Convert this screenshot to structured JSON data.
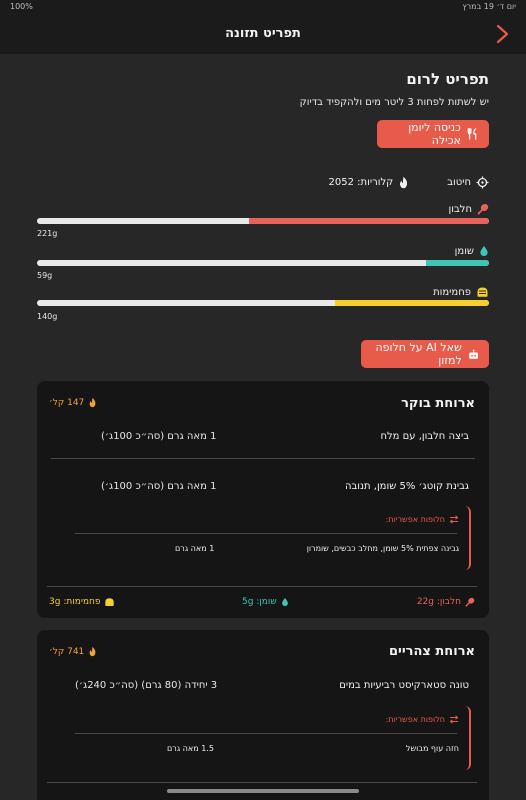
{
  "statusbar": {
    "battery": "100%",
    "date": "יום ד׳ 19 במרץ"
  },
  "header": {
    "title": "תפריט תזונה"
  },
  "menu": {
    "title": "תפריט לרום",
    "subtitle": "יש לשתות לפחות 3 ליטר מים ולהקפיד בדיוק",
    "journal_button": "כניסה ליומן אכילה",
    "ai_button": "שאל AI על חלופה למזון",
    "goal_label": "חיטוב",
    "calories_label": "קלוריות: 2052",
    "colors": {
      "accent": "#e85a4a",
      "protein": "#e8635c",
      "fat": "#3ec6b5",
      "carbs": "#f4cf2e",
      "calorie": "#f0a33a"
    }
  },
  "macros": [
    {
      "name": "חלבון",
      "value": "221g",
      "icon": "drumstick-icon",
      "fraction": 0.53,
      "color": "#e8635c"
    },
    {
      "name": "שומן",
      "value": "59g",
      "icon": "droplet-icon",
      "fraction": 0.14,
      "color": "#3ec6b5"
    },
    {
      "name": "פחמימות",
      "value": "140g",
      "icon": "bread-icon",
      "fraction": 0.34,
      "color": "#f4cf2e"
    }
  ],
  "meals": [
    {
      "title": "ארוחת בוקר",
      "calories": "147 קל׳",
      "items": [
        {
          "name": "ביצה חלבון, עם מלח",
          "qty": "1 מאה גרם (סה״כ 100ג׳)"
        },
        {
          "name": "גבינת קוטג׳ 5% שומן, תנובה",
          "qty": "1 מאה גרם (סה״כ 100ג׳)"
        }
      ],
      "alternatives_label": "חלופות אפשריות:",
      "alternatives": [
        {
          "name": "גבינה צפתית 5% שומן, מחלב כבשים, שומרון",
          "qty": "1 מאה גרם"
        }
      ],
      "footer": {
        "protein": "חלבון: 22g",
        "fat": "שומן: 5g",
        "carbs": "פחמימות: 3g"
      }
    },
    {
      "title": "ארוחת צהריים",
      "calories": "741 קל׳",
      "items": [
        {
          "name": "טונה סטארקיסט רביעיות במים",
          "qty": "3 יחידה (80 גרם) (סה״כ 240ג׳)"
        }
      ],
      "alternatives_label": "חלופות אפשריות:",
      "alternatives": [
        {
          "name": "חזה עוף מבושל",
          "qty": "1.5 מאה גרם"
        }
      ]
    }
  ]
}
